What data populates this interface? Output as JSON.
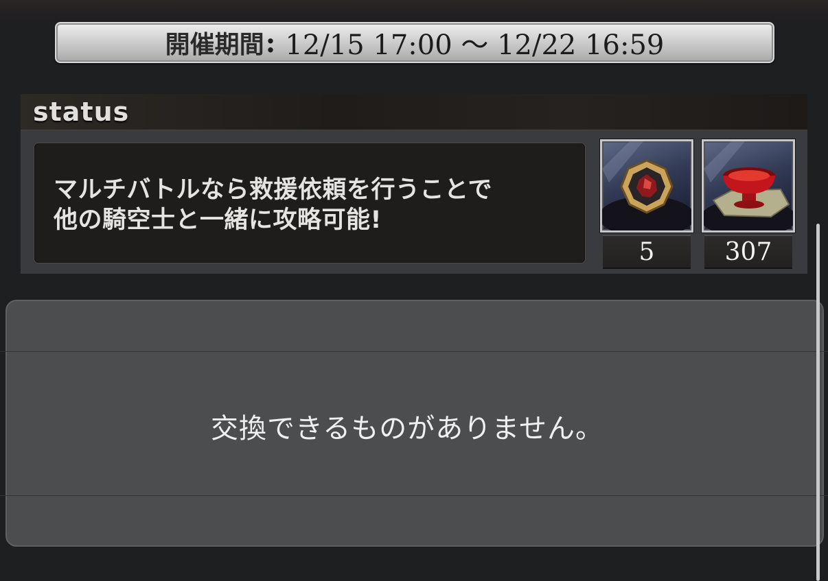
{
  "period": {
    "label": "開催期間",
    "separator": ":",
    "range": "12/15 17:00 〜 12/22 16:59"
  },
  "status": {
    "title": "status",
    "message_line1": "マルチバトルなら救援依頼を行うことで",
    "message_line2": "他の騎空士と一緒に攻略可能!"
  },
  "items": [
    {
      "icon": "gem-medal-icon",
      "count": "5"
    },
    {
      "icon": "red-cup-icon",
      "count": "307"
    }
  ],
  "exchange_list": {
    "empty_message": "交換できるものがありません。"
  }
}
